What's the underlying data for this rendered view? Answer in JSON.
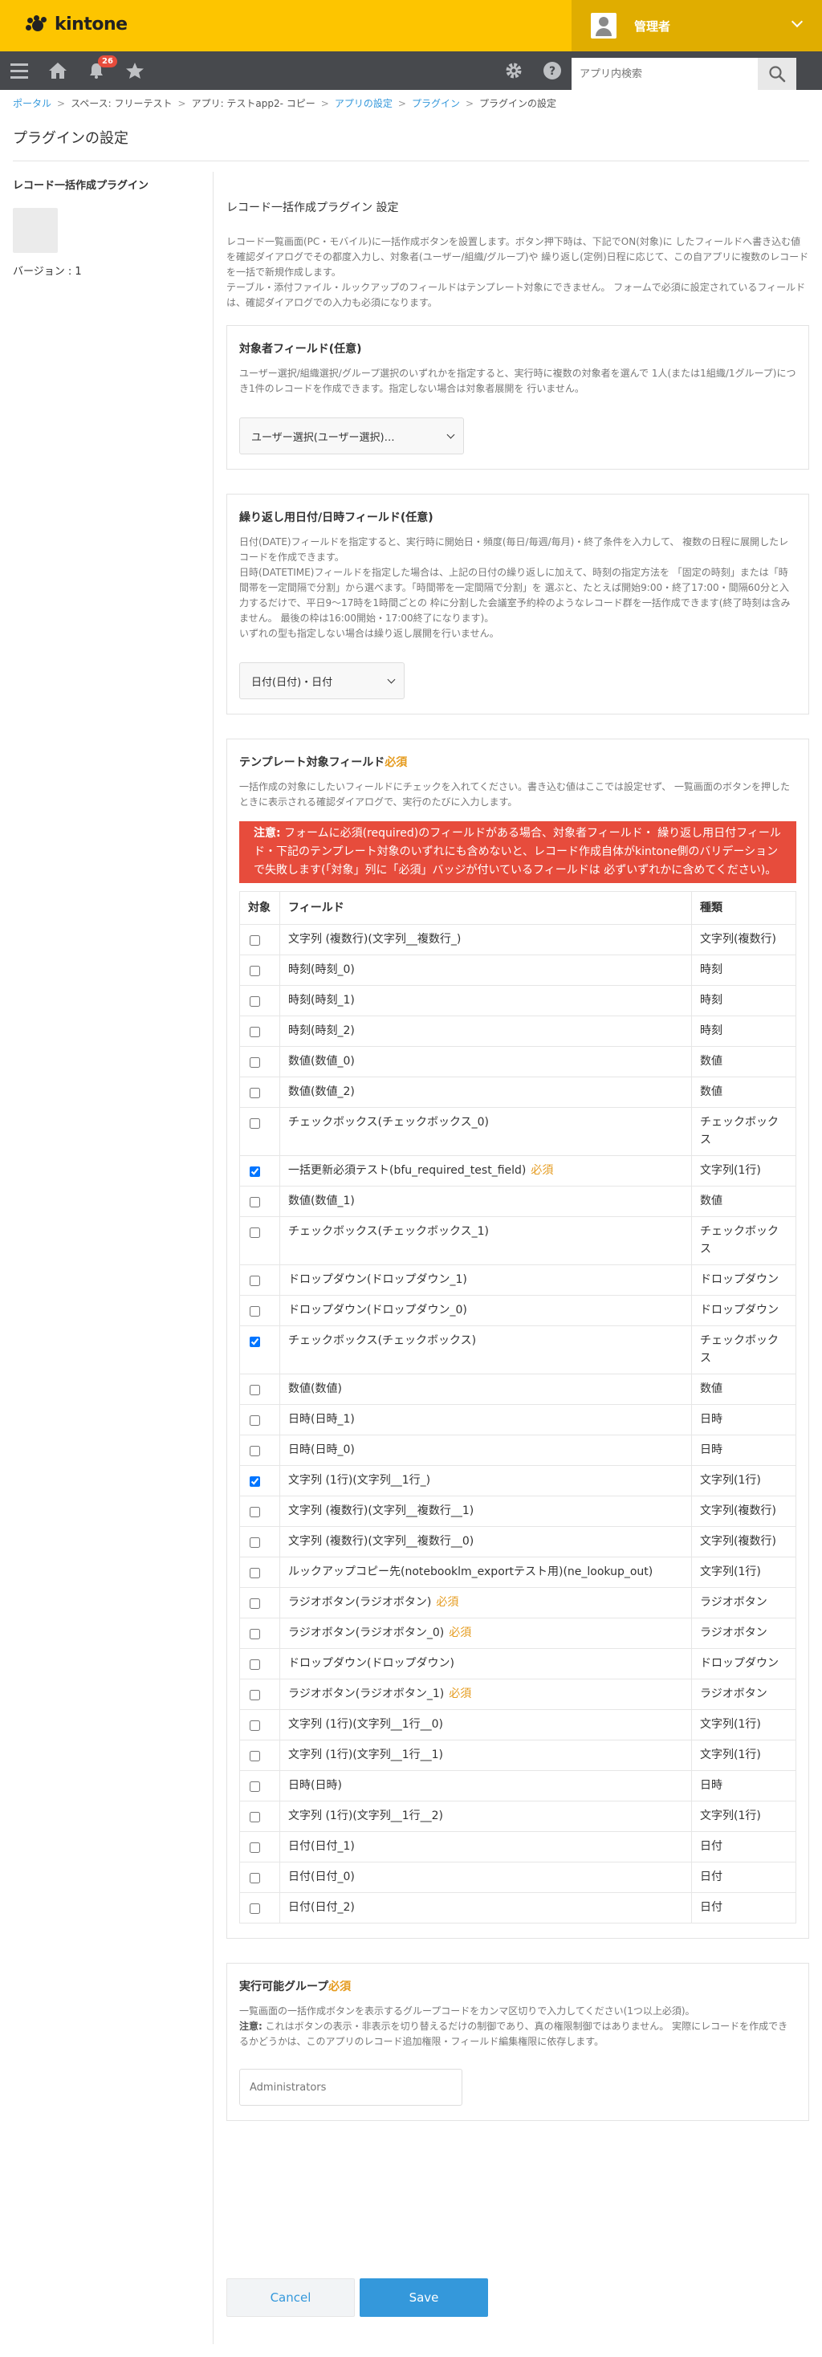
{
  "header": {
    "logo_text": "kintone",
    "user_name": "管理者"
  },
  "nav": {
    "notification_count": "26",
    "search_placeholder": "アプリ内検索"
  },
  "breadcrumb": [
    "ポータル",
    "スペース: フリーテスト",
    "アプリ: テストapp2- コピー",
    "アプリの設定",
    "プラグイン",
    "プラグインの設定"
  ],
  "page": {
    "title": "プラグインの設定"
  },
  "sidebar": {
    "plugin_name": "レコード一括作成プラグイン",
    "version": "バージョン : 1"
  },
  "main": {
    "heading": "レコード一括作成プラグイン 設定",
    "intro1": "レコード一覧画面(PC・モバイル)に一括作成ボタンを設置します。ボタン押下時は、下記でON(対象)に したフィールドへ書き込む値を確認ダイアログでその都度入力し、対象者(ユーザー/組織/グループ)や 繰り返し(定例)日程に応じて、この自アプリに複数のレコードを一括で新規作成します。",
    "intro2": "テーブル・添付ファイル・ルックアップのフィールドはテンプレート対象にできません。 フォームで必須に設定されているフィールドは、確認ダイアログでの入力も必須になります。"
  },
  "target_section": {
    "title": "対象者フィールド(任意)",
    "desc": "ユーザー選択/組織選択/グループ選択のいずれかを指定すると、実行時に複数の対象者を選んで 1人(または1組織/1グループ)につき1件のレコードを作成できます。指定しない場合は対象者展開を 行いません。",
    "select_value": "ユーザー選択(ユーザー選択)…"
  },
  "repeat_section": {
    "title": "繰り返し用日付/日時フィールド(任意)",
    "desc1": "日付(DATE)フィールドを指定すると、実行時に開始日・頻度(毎日/毎週/毎月)・終了条件を入力して、 複数の日程に展開したレコードを作成できます。",
    "desc2": "日時(DATETIME)フィールドを指定した場合は、上記の日付の繰り返しに加えて、時刻の指定方法を 「固定の時刻」または「時間帯を一定間隔で分割」から選べます。「時間帯を一定間隔で分割」を 選ぶと、たとえば開始9:00・終了17:00・間隔60分と入力するだけで、平日9〜17時を1時間ごとの 枠に分割した会議室予約枠のようなレコード群を一括作成できます(終了時刻は含みません。 最後の枠は16:00開始・17:00終了になります)。",
    "desc3": "いずれの型も指定しない場合は繰り返し展開を行いません。",
    "select_value": "日付(日付)・日付"
  },
  "template_section": {
    "title": "テンプレート対象フィールド",
    "required_label": "必須",
    "desc": "一括作成の対象にしたいフィールドにチェックを入れてください。書き込む値はここでは設定せず、 一覧画面のボタンを押したときに表示される確認ダイアログで、実行のたびに入力します。",
    "alert_prefix": "注意:",
    "alert_text": " フォームに必須(required)のフィールドがある場合、対象者フィールド・ 繰り返し用日付フィールド・下記のテンプレート対象のいずれにも含めないと、レコード作成自体がkintone側のバリデーションで失敗します(「対象」列に「必須」バッジが付いているフィールドは 必ずいずれかに含めてください)。",
    "col_target": "対象",
    "col_field": "フィールド",
    "col_type": "種類",
    "required_badge": "必須",
    "rows": [
      {
        "checked": false,
        "field": "文字列 (複数行)(文字列__複数行_)",
        "type": "文字列(複数行)",
        "required": false
      },
      {
        "checked": false,
        "field": "時刻(時刻_0)",
        "type": "時刻",
        "required": false
      },
      {
        "checked": false,
        "field": "時刻(時刻_1)",
        "type": "時刻",
        "required": false
      },
      {
        "checked": false,
        "field": "時刻(時刻_2)",
        "type": "時刻",
        "required": false
      },
      {
        "checked": false,
        "field": "数値(数値_0)",
        "type": "数値",
        "required": false
      },
      {
        "checked": false,
        "field": "数値(数値_2)",
        "type": "数値",
        "required": false
      },
      {
        "checked": false,
        "field": "チェックボックス(チェックボックス_0)",
        "type": "チェックボックス",
        "required": false
      },
      {
        "checked": true,
        "field": "一括更新必須テスト(bfu_required_test_field)",
        "type": "文字列(1行)",
        "required": true
      },
      {
        "checked": false,
        "field": "数値(数値_1)",
        "type": "数値",
        "required": false
      },
      {
        "checked": false,
        "field": "チェックボックス(チェックボックス_1)",
        "type": "チェックボックス",
        "required": false
      },
      {
        "checked": false,
        "field": "ドロップダウン(ドロップダウン_1)",
        "type": "ドロップダウン",
        "required": false
      },
      {
        "checked": false,
        "field": "ドロップダウン(ドロップダウン_0)",
        "type": "ドロップダウン",
        "required": false
      },
      {
        "checked": true,
        "field": "チェックボックス(チェックボックス)",
        "type": "チェックボックス",
        "required": false
      },
      {
        "checked": false,
        "field": "数値(数値)",
        "type": "数値",
        "required": false
      },
      {
        "checked": false,
        "field": "日時(日時_1)",
        "type": "日時",
        "required": false
      },
      {
        "checked": false,
        "field": "日時(日時_0)",
        "type": "日時",
        "required": false
      },
      {
        "checked": true,
        "field": "文字列 (1行)(文字列__1行_)",
        "type": "文字列(1行)",
        "required": false
      },
      {
        "checked": false,
        "field": "文字列 (複数行)(文字列__複数行__1)",
        "type": "文字列(複数行)",
        "required": false
      },
      {
        "checked": false,
        "field": "文字列 (複数行)(文字列__複数行__0)",
        "type": "文字列(複数行)",
        "required": false
      },
      {
        "checked": false,
        "field": "ルックアップコピー先(notebooklm_exportテスト用)(ne_lookup_out)",
        "type": "文字列(1行)",
        "required": false
      },
      {
        "checked": false,
        "field": "ラジオボタン(ラジオボタン)",
        "type": "ラジオボタン",
        "required": true
      },
      {
        "checked": false,
        "field": "ラジオボタン(ラジオボタン_0)",
        "type": "ラジオボタン",
        "required": true
      },
      {
        "checked": false,
        "field": "ドロップダウン(ドロップダウン)",
        "type": "ドロップダウン",
        "required": false
      },
      {
        "checked": false,
        "field": "ラジオボタン(ラジオボタン_1)",
        "type": "ラジオボタン",
        "required": true
      },
      {
        "checked": false,
        "field": "文字列 (1行)(文字列__1行__0)",
        "type": "文字列(1行)",
        "required": false
      },
      {
        "checked": false,
        "field": "文字列 (1行)(文字列__1行__1)",
        "type": "文字列(1行)",
        "required": false
      },
      {
        "checked": false,
        "field": "日時(日時)",
        "type": "日時",
        "required": false
      },
      {
        "checked": false,
        "field": "文字列 (1行)(文字列__1行__2)",
        "type": "文字列(1行)",
        "required": false
      },
      {
        "checked": false,
        "field": "日付(日付_1)",
        "type": "日付",
        "required": false
      },
      {
        "checked": false,
        "field": "日付(日付_0)",
        "type": "日付",
        "required": false
      },
      {
        "checked": false,
        "field": "日付(日付_2)",
        "type": "日付",
        "required": false
      }
    ]
  },
  "group_section": {
    "title": "実行可能グループ",
    "required_label": "必須",
    "desc1": "一覧画面の一括作成ボタンを表示するグループコードをカンマ区切りで入力してください(1つ以上必須)。",
    "note_label": "注意:",
    "desc2": " これはボタンの表示・非表示を切り替えるだけの制御であり、真の権限制御ではありません。 実際にレコードを作成できるかどうかは、このアプリのレコード追加権限・フィールド編集権限に依存します。",
    "placeholder": "Administrators"
  },
  "buttons": {
    "cancel": "Cancel",
    "save": "Save"
  },
  "colors": {
    "header": "#fdc500",
    "accent": "#3498db",
    "required": "#e59b1e",
    "alert": "#e74c3c"
  }
}
